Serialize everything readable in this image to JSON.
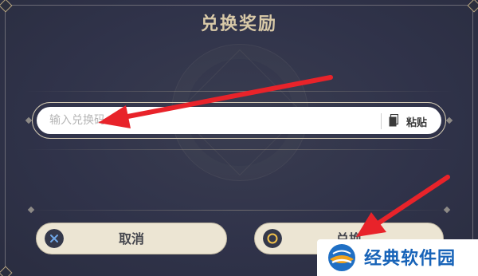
{
  "dialog": {
    "title": "兑换奖励",
    "input": {
      "placeholder": "输入兑换码",
      "value": ""
    },
    "paste_label": "粘贴",
    "cancel_label": "取消",
    "confirm_label": "兑换"
  },
  "watermark": {
    "text": "经典软件园"
  },
  "colors": {
    "background": "#30334a",
    "title": "#d8c9a7",
    "button": "#ece5d3",
    "arrow": "#e8232a",
    "watermark": "#1763b8"
  },
  "icons": {
    "paste": "clipboard-icon",
    "cancel": "cross-icon",
    "confirm": "circle-icon"
  }
}
